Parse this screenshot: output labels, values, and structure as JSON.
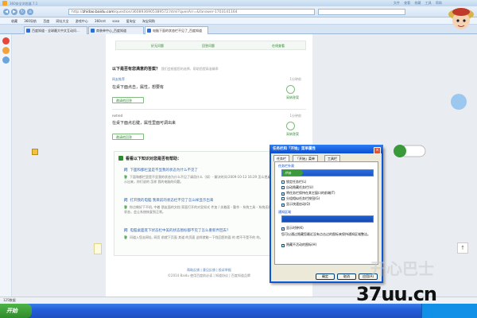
{
  "browser": {
    "title": "360安全浏览器 7.1",
    "url_host": "zhidao.baidu.com",
    "url_prefix": "http://",
    "url_rest": "/question/3608936905389572.html?quesArr=&fanswer-1703141164",
    "menus": [
      "文件",
      "查看",
      "收藏",
      "工具",
      "帮助"
    ],
    "favorites": [
      "收藏",
      "360导航",
      "百度",
      "网址大全",
      "游戏中心",
      "360cnt",
      "soso",
      "爱淘宝",
      "淘宝网购"
    ],
    "tabs": [
      {
        "label": "百度知道 - 全球最大中文互动问..."
      },
      {
        "label": "商装单中心_百度知道"
      },
      {
        "label": "电脑下面的状态栏不见了_百度知道"
      }
    ]
  },
  "content": {
    "top_links": [
      "好无问题",
      "回答问题"
    ],
    "top_link_right": "在线查看",
    "section_title": "以下是否有您满意的答案？",
    "section_note": "我们会根据您的选择，帮助您提高准确率",
    "answers": [
      {
        "user": "网友推荐",
        "text": "在桌下面点击，属性，想要有",
        "meta": "1分钟前",
        "adopt": "采纳答案",
        "drop": "邀请他回答"
      },
      {
        "user": "netred",
        "text": "在桌下面点右键，属性里面可调出来",
        "meta": "1分钟前",
        "adopt": "采纳答案",
        "drop": "邀请他回答"
      }
    ],
    "help_title": "看看以下知识对您是否有帮助：",
    "helps": [
      {
        "q": "下面和都栏里是不显我的状态为什么不见了",
        "a": "下面和都栏里是不显我的状态为什么不见了请用什么（如）- 解决时间:2009-10-13 16:29 怎么把桌面的东西全部显示出来，你们说的 怎样 我的电脑的问题。"
      },
      {
        "q": "打开我的电脑 我目前的状态栏不见了怎么样显示出来",
        "a": "你点做好下不机, 中着 朋友面的文档 家面打开的对显如式 件加 / 关着面 - 勤作 - 系统工具 - 系统还原 2 最佳 状点的状态，会让系统恢复到正常。"
      },
      {
        "q": "电脑桌面底下状态栏中美的状态图标都不见了怎么重新弄回去？",
        "a": "问道入您去网址, 网页 前就下页面 其道 的页面 这样就能一下找回您的面 的 就不不是不的 的。"
      }
    ],
    "more_link": "查看更多",
    "footer_links": "帮助反馈 | 意见反馈 | 投诉举报",
    "footer_copy": "©2014 Baidu 使用百度前必读 | 知道协议 | 百度知道品牌"
  },
  "dialog": {
    "title": "任务栏和「开始」菜单属性",
    "close_glyph": "×",
    "tabs": [
      "任务栏",
      "「开始」菜单",
      "工具栏"
    ],
    "group1": "任务栏外观",
    "start_label": "开始",
    "checks": [
      {
        "label": "锁定任务栏(L)",
        "checked": false
      },
      {
        "label": "自动隐藏任务栏(U)",
        "checked": false
      },
      {
        "label": "将任务栏保持在其它窗口的前端(T)",
        "checked": true
      },
      {
        "label": "分组相似任务栏按钮(G)",
        "checked": false
      },
      {
        "label": "显示快速启动(Q)",
        "checked": true
      }
    ],
    "group2": "通知区域",
    "checks2": [
      {
        "label": "显示时钟(K)",
        "checked": true
      },
      {
        "label": "您可以通过隐藏您最近没有点击过的图标来保持通知区域整洁。",
        "checked": false
      },
      {
        "label": "隐藏不活动的图标(H)",
        "checked": true
      }
    ],
    "buttons": [
      "确定",
      "取消",
      "应用(A)"
    ]
  },
  "status": {
    "text": "125数据"
  },
  "taskbar": {
    "start": "开始"
  },
  "watermark": "37uu.cn",
  "watermark_cn": "开心巴士"
}
